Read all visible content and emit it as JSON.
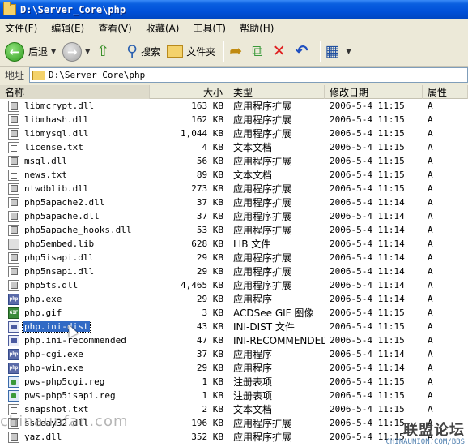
{
  "window": {
    "title": "D:\\Server_Core\\php"
  },
  "menu": [
    "文件(F)",
    "编辑(E)",
    "查看(V)",
    "收藏(A)",
    "工具(T)",
    "帮助(H)"
  ],
  "toolbar": {
    "back": "后退",
    "search": "搜索",
    "folders": "文件夹"
  },
  "address": {
    "label": "地址",
    "path": "D:\\Server_Core\\php"
  },
  "columns": {
    "name": "名称",
    "size": "大小",
    "type": "类型",
    "date": "修改日期",
    "attr": "属性"
  },
  "files": [
    {
      "name": "libmcrypt.dll",
      "size": "163 KB",
      "type": "应用程序扩展",
      "date": "2006-5-4 11:15",
      "attr": "A",
      "icon": "dll"
    },
    {
      "name": "libmhash.dll",
      "size": "162 KB",
      "type": "应用程序扩展",
      "date": "2006-5-4 11:15",
      "attr": "A",
      "icon": "dll"
    },
    {
      "name": "libmysql.dll",
      "size": "1,044 KB",
      "type": "应用程序扩展",
      "date": "2006-5-4 11:15",
      "attr": "A",
      "icon": "dll"
    },
    {
      "name": "license.txt",
      "size": "4 KB",
      "type": "文本文档",
      "date": "2006-5-4 11:15",
      "attr": "A",
      "icon": "txt"
    },
    {
      "name": "msql.dll",
      "size": "56 KB",
      "type": "应用程序扩展",
      "date": "2006-5-4 11:15",
      "attr": "A",
      "icon": "dll"
    },
    {
      "name": "news.txt",
      "size": "89 KB",
      "type": "文本文档",
      "date": "2006-5-4 11:15",
      "attr": "A",
      "icon": "txt"
    },
    {
      "name": "ntwdblib.dll",
      "size": "273 KB",
      "type": "应用程序扩展",
      "date": "2006-5-4 11:15",
      "attr": "A",
      "icon": "dll"
    },
    {
      "name": "php5apache2.dll",
      "size": "37 KB",
      "type": "应用程序扩展",
      "date": "2006-5-4 11:14",
      "attr": "A",
      "icon": "dll"
    },
    {
      "name": "php5apache.dll",
      "size": "37 KB",
      "type": "应用程序扩展",
      "date": "2006-5-4 11:14",
      "attr": "A",
      "icon": "dll"
    },
    {
      "name": "php5apache_hooks.dll",
      "size": "53 KB",
      "type": "应用程序扩展",
      "date": "2006-5-4 11:14",
      "attr": "A",
      "icon": "dll"
    },
    {
      "name": "php5embed.lib",
      "size": "628 KB",
      "type": "LIB 文件",
      "date": "2006-5-4 11:14",
      "attr": "A",
      "icon": "lib"
    },
    {
      "name": "php5isapi.dll",
      "size": "29 KB",
      "type": "应用程序扩展",
      "date": "2006-5-4 11:14",
      "attr": "A",
      "icon": "dll"
    },
    {
      "name": "php5nsapi.dll",
      "size": "29 KB",
      "type": "应用程序扩展",
      "date": "2006-5-4 11:14",
      "attr": "A",
      "icon": "dll"
    },
    {
      "name": "php5ts.dll",
      "size": "4,465 KB",
      "type": "应用程序扩展",
      "date": "2006-5-4 11:14",
      "attr": "A",
      "icon": "dll"
    },
    {
      "name": "php.exe",
      "size": "29 KB",
      "type": "应用程序",
      "date": "2006-5-4 11:14",
      "attr": "A",
      "icon": "exe"
    },
    {
      "name": "php.gif",
      "size": "3 KB",
      "type": "ACDSee GIF 图像",
      "date": "2006-5-4 11:15",
      "attr": "A",
      "icon": "gif"
    },
    {
      "name": "php.ini-dist",
      "size": "43 KB",
      "type": "INI-DIST 文件",
      "date": "2006-5-4 11:15",
      "attr": "A",
      "icon": "ini",
      "selected": true
    },
    {
      "name": "php.ini-recommended",
      "size": "47 KB",
      "type": "INI-RECOMMENDED...",
      "date": "2006-5-4 11:15",
      "attr": "A",
      "icon": "ini"
    },
    {
      "name": "php-cgi.exe",
      "size": "37 KB",
      "type": "应用程序",
      "date": "2006-5-4 11:14",
      "attr": "A",
      "icon": "exe"
    },
    {
      "name": "php-win.exe",
      "size": "29 KB",
      "type": "应用程序",
      "date": "2006-5-4 11:14",
      "attr": "A",
      "icon": "exe"
    },
    {
      "name": "pws-php5cgi.reg",
      "size": "1 KB",
      "type": "注册表项",
      "date": "2006-5-4 11:15",
      "attr": "A",
      "icon": "reg"
    },
    {
      "name": "pws-php5isapi.reg",
      "size": "1 KB",
      "type": "注册表项",
      "date": "2006-5-4 11:15",
      "attr": "A",
      "icon": "reg"
    },
    {
      "name": "snapshot.txt",
      "size": "2 KB",
      "type": "文本文档",
      "date": "2006-5-4 11:15",
      "attr": "A",
      "icon": "txt"
    },
    {
      "name": "ssleay32.dll",
      "size": "196 KB",
      "type": "应用程序扩展",
      "date": "2006-5-4 11:15",
      "attr": "A",
      "icon": "dll"
    },
    {
      "name": "yaz.dll",
      "size": "352 KB",
      "type": "应用程序扩展",
      "date": "2006-5-4 11:15",
      "attr": "A",
      "icon": "dll"
    }
  ],
  "watermark": {
    "text": "chinaunfan.com",
    "logo": "联盟论坛",
    "logo_sub": "CHINAUNION.COM/BBS"
  }
}
